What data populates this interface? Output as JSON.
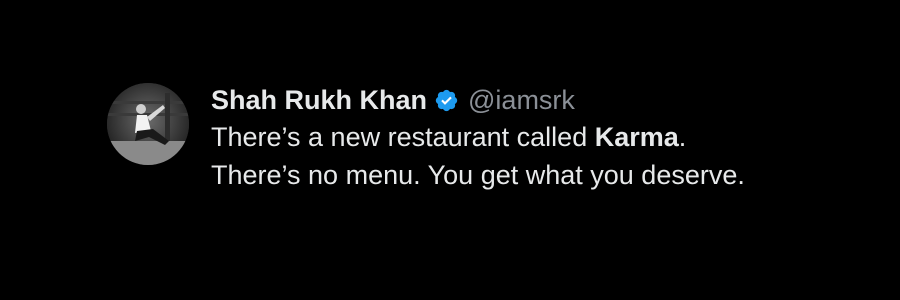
{
  "tweet": {
    "author": {
      "display_name": "Shah Rukh Khan",
      "handle": "@iamsrk",
      "verified": true,
      "verified_icon": "verified-badge-icon",
      "verified_color": "#1d9bf0"
    },
    "text": {
      "before_bold": "There’s a new restaurant called ",
      "bold": "Karma",
      "after_bold": ". There’s no menu. You get what you deserve."
    }
  },
  "theme": {
    "background": "#000000",
    "text_color": "#e7e9ea",
    "handle_color": "#8b9097"
  }
}
